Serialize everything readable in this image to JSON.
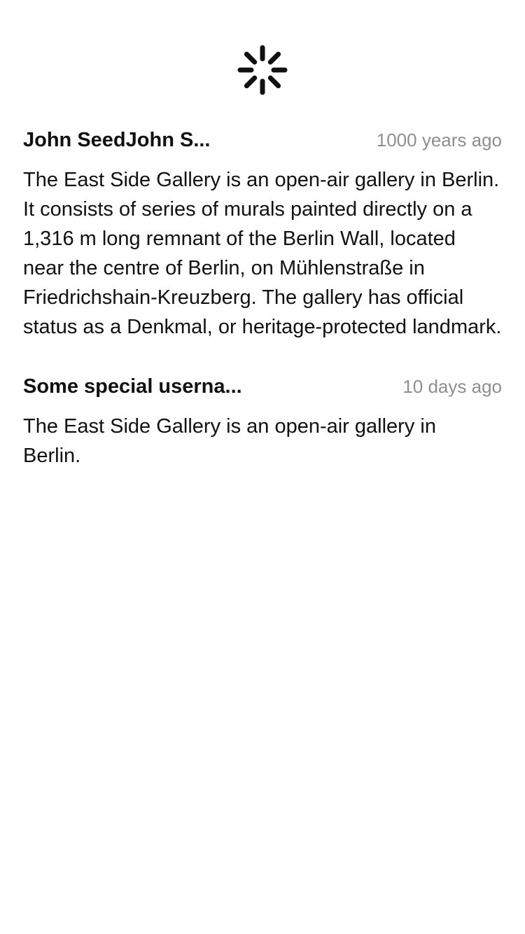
{
  "loader": {
    "icon": "activity-spinner-icon",
    "color": "#111111"
  },
  "comments": [
    {
      "author": "John SeedJohn S...",
      "time": "1000 years ago",
      "body": "The East Side Gallery is an open-air gallery in Berlin. It consists of series of murals painted directly on a 1,316 m long remnant of the Berlin Wall, located near the centre of Berlin, on Mühlenstraße in Friedrichshain-Kreuzberg. The gallery has official status as a Denkmal, or heritage-protected landmark."
    },
    {
      "author": "Some special userna...",
      "time": "10 days ago",
      "body": "The East Side Gallery is an open-air gallery in Berlin."
    }
  ],
  "colors": {
    "text": "#111111",
    "secondary": "#8e8e93",
    "background": "#ffffff"
  }
}
